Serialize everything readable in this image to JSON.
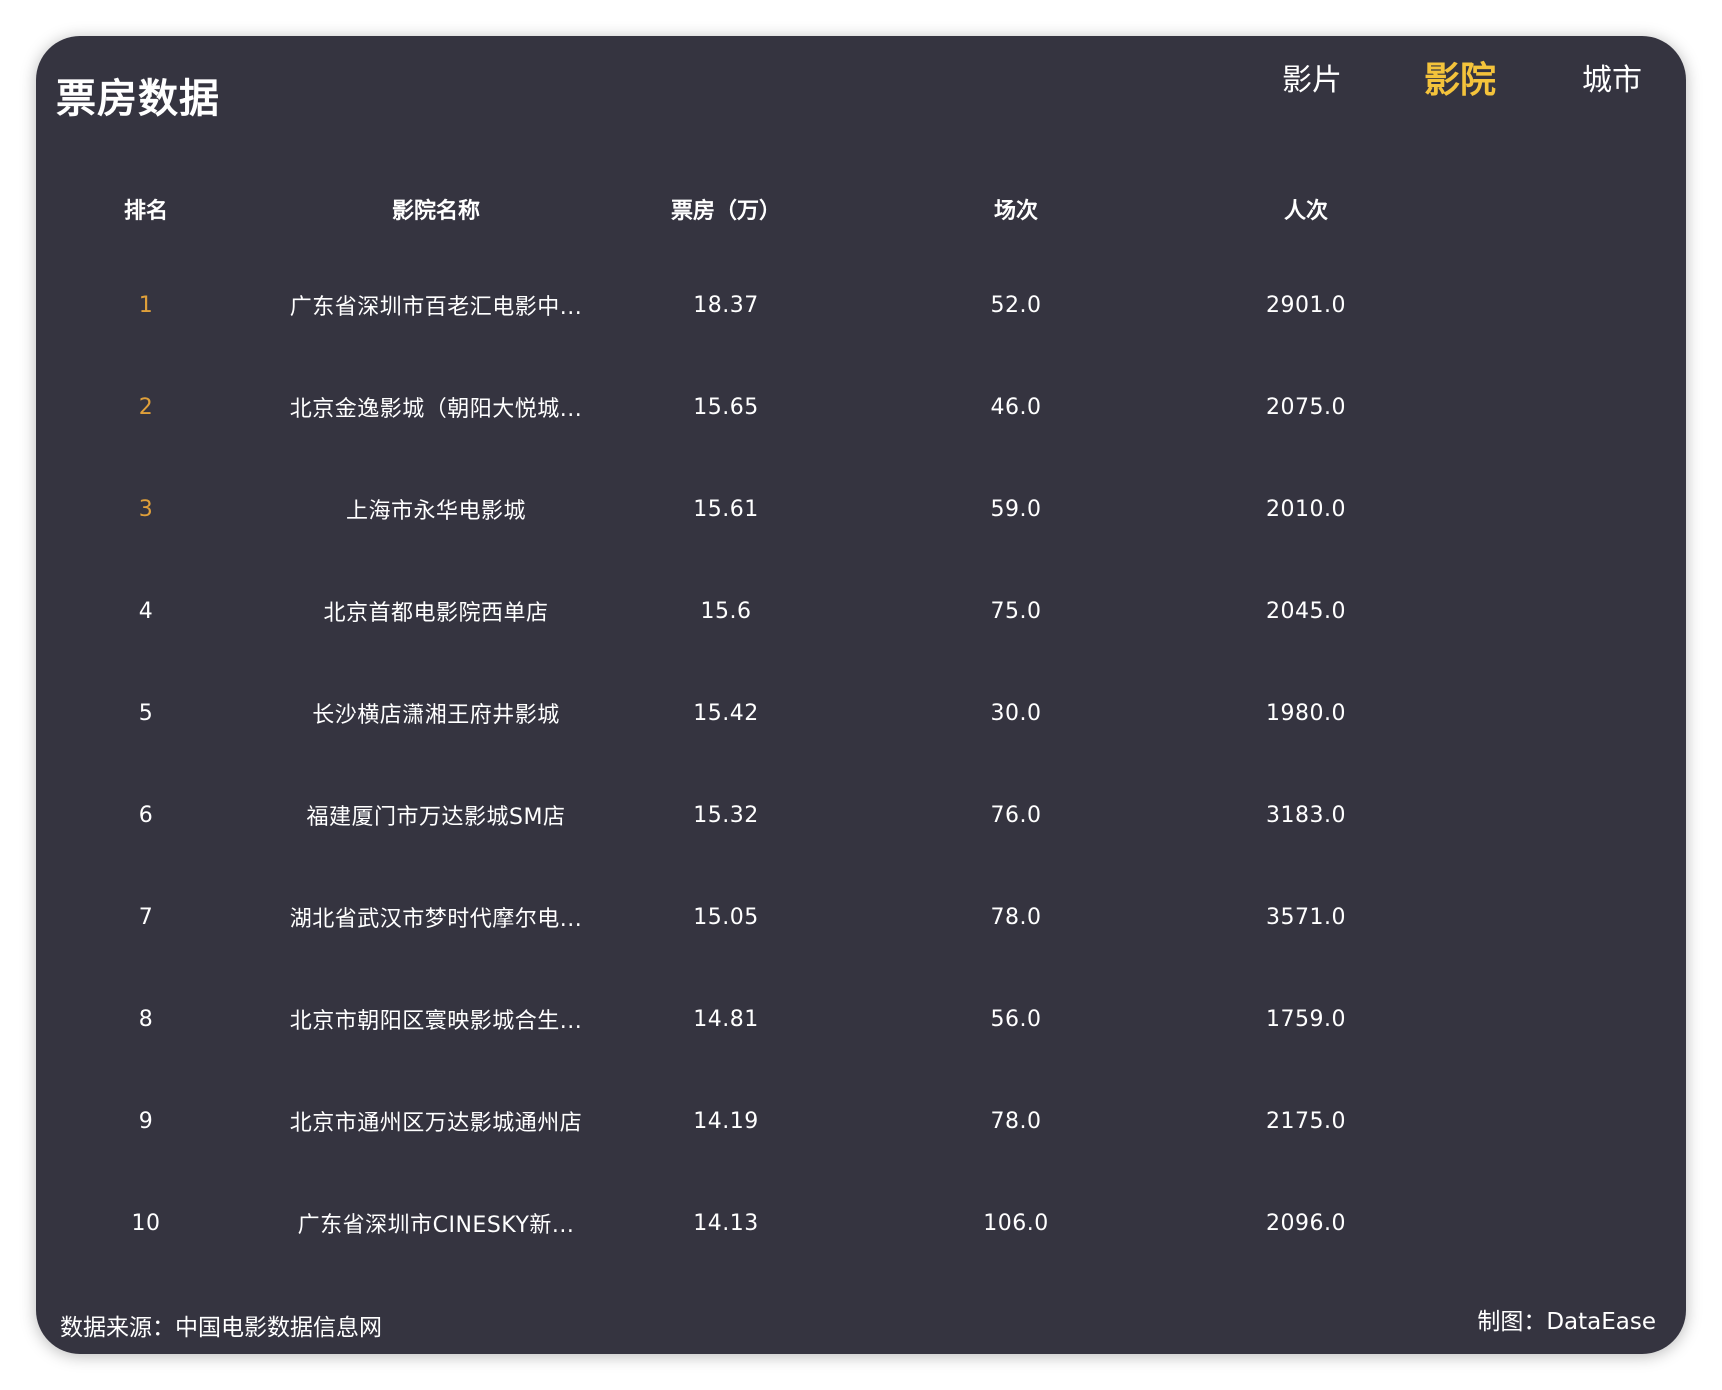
{
  "title": "票房数据",
  "tabs": [
    {
      "label": "影片",
      "active": false
    },
    {
      "label": "影院",
      "active": true
    },
    {
      "label": "城市",
      "active": false
    }
  ],
  "colors": {
    "background": "#353440",
    "active_tab": "#f4c33b",
    "top_rank": "#e0a03a",
    "text": "#ffffff"
  },
  "table": {
    "headers": [
      "排名",
      "影院名称",
      "票房（万）",
      "场次",
      "人次"
    ],
    "rows": [
      [
        "1",
        "广东省深圳市百老汇电影中...",
        "18.37",
        "52.0",
        "2901.0"
      ],
      [
        "2",
        "北京金逸影城（朝阳大悦城...",
        "15.65",
        "46.0",
        "2075.0"
      ],
      [
        "3",
        "上海市永华电影城",
        "15.61",
        "59.0",
        "2010.0"
      ],
      [
        "4",
        "北京首都电影院西单店",
        "15.6",
        "75.0",
        "2045.0"
      ],
      [
        "5",
        "长沙横店潇湘王府井影城",
        "15.42",
        "30.0",
        "1980.0"
      ],
      [
        "6",
        "福建厦门市万达影城SM店",
        "15.32",
        "76.0",
        "3183.0"
      ],
      [
        "7",
        "湖北省武汉市梦时代摩尔电...",
        "15.05",
        "78.0",
        "3571.0"
      ],
      [
        "8",
        "北京市朝阳区寰映影城合生...",
        "14.81",
        "56.0",
        "1759.0"
      ],
      [
        "9",
        "北京市通州区万达影城通州店",
        "14.19",
        "78.0",
        "2175.0"
      ],
      [
        "10",
        "广东省深圳市CINESKY新...",
        "14.13",
        "106.0",
        "2096.0"
      ]
    ]
  },
  "footer": {
    "source": "数据来源：中国电影数据信息网",
    "credit": "制图：DataEase"
  }
}
